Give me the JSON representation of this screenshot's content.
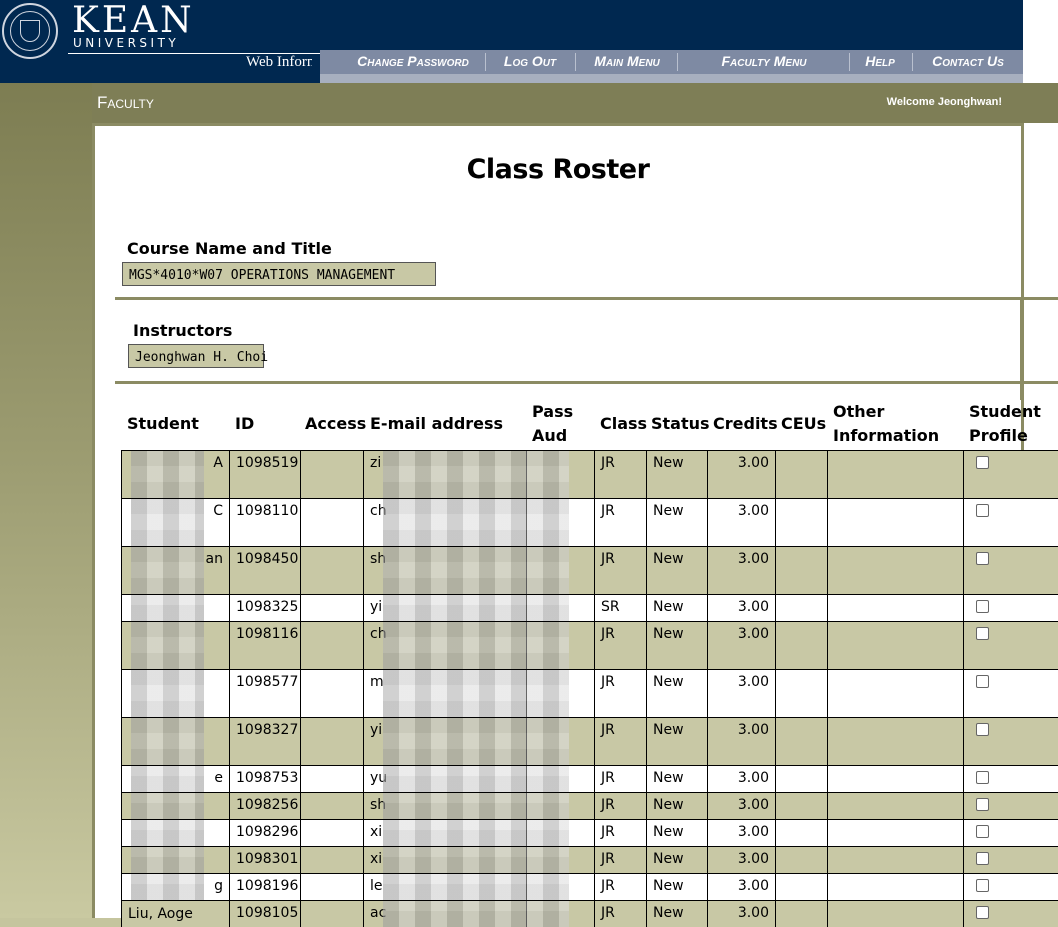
{
  "brand": {
    "name": "KEAN",
    "subtitle": "UNIVERSITY",
    "web_info": "Web Information"
  },
  "nav": {
    "items": [
      "Change Password",
      "Log Out",
      "Main Menu",
      "Faculty Menu",
      "Help",
      "Contact Us"
    ]
  },
  "header": {
    "section": "Faculty",
    "welcome": "Welcome Jeonghwan!"
  },
  "page": {
    "title": "Class Roster",
    "course_label": "Course Name and Title",
    "course_value": "MGS*4010*W07 OPERATIONS MANAGEMENT",
    "instructors_label": "Instructors",
    "instructor_value": "Jeonghwan H. Choi"
  },
  "table": {
    "headers": {
      "student": "Student",
      "id": "ID",
      "access": "Access",
      "email": "E-mail address",
      "pass_aud_1": "Pass",
      "pass_aud_2": "Aud",
      "class": "Class",
      "status": "Status",
      "credits": "Credits",
      "ceus": "CEUs",
      "other_1": "Other",
      "other_2": "Information",
      "profile_1": "Student",
      "profile_2": "Profile"
    },
    "rows": [
      {
        "name": "A",
        "id": "1098519",
        "email": "zi",
        "class": "JR",
        "status": "New",
        "credits": "3.00"
      },
      {
        "name": "C",
        "id": "1098110",
        "email": "ch",
        "class": "JR",
        "status": "New",
        "credits": "3.00"
      },
      {
        "name": "an",
        "id": "1098450",
        "email": "sh",
        "class": "JR",
        "status": "New",
        "credits": "3.00"
      },
      {
        "name": "",
        "id": "1098325",
        "email": "yi",
        "class": "SR",
        "status": "New",
        "credits": "3.00"
      },
      {
        "name": "",
        "id": "1098116",
        "email": "ch",
        "class": "JR",
        "status": "New",
        "credits": "3.00"
      },
      {
        "name": "",
        "id": "1098577",
        "email": "m",
        "class": "JR",
        "status": "New",
        "credits": "3.00"
      },
      {
        "name": "",
        "id": "1098327",
        "email": "yi",
        "class": "JR",
        "status": "New",
        "credits": "3.00"
      },
      {
        "name": "e",
        "id": "1098753",
        "email": "yu",
        "class": "JR",
        "status": "New",
        "credits": "3.00"
      },
      {
        "name": "",
        "id": "1098256",
        "email": "sh",
        "class": "JR",
        "status": "New",
        "credits": "3.00"
      },
      {
        "name": "",
        "id": "1098296",
        "email": "xi",
        "class": "JR",
        "status": "New",
        "credits": "3.00"
      },
      {
        "name": "",
        "id": "1098301",
        "email": "xi",
        "class": "JR",
        "status": "New",
        "credits": "3.00"
      },
      {
        "name": "g",
        "id": "1098196",
        "email": "le",
        "class": "JR",
        "status": "New",
        "credits": "3.00"
      },
      {
        "name": "Liu, Aoge",
        "id": "1098105",
        "email": "ac",
        "class": "JR",
        "status": "New",
        "credits": "3.00"
      }
    ]
  },
  "colors": {
    "navy": "#002850",
    "olive": "#7e7e56",
    "khaki": "#c8c8a5",
    "nav_gray": "#7e8aa3"
  }
}
